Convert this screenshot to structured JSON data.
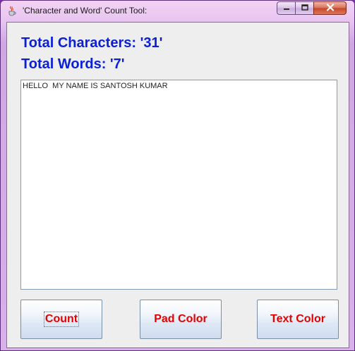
{
  "window": {
    "title": "'Character and Word' Count Tool:",
    "app_icon": "java-cup-icon",
    "controls": {
      "minimize_icon": "minimize-icon",
      "maximize_icon": "maximize-icon",
      "close_icon": "close-icon"
    }
  },
  "stats": {
    "characters_label": "Total Characters: '31'",
    "words_label": "Total Words: '7'"
  },
  "editor": {
    "text": "HELLO  MY NAME IS SANTOSH KUMAR"
  },
  "buttons": {
    "count": "Count",
    "pad_color": "Pad Color",
    "text_color": "Text Color"
  },
  "colors": {
    "label_blue": "#0a1fd6",
    "button_text_red": "#e60000"
  }
}
